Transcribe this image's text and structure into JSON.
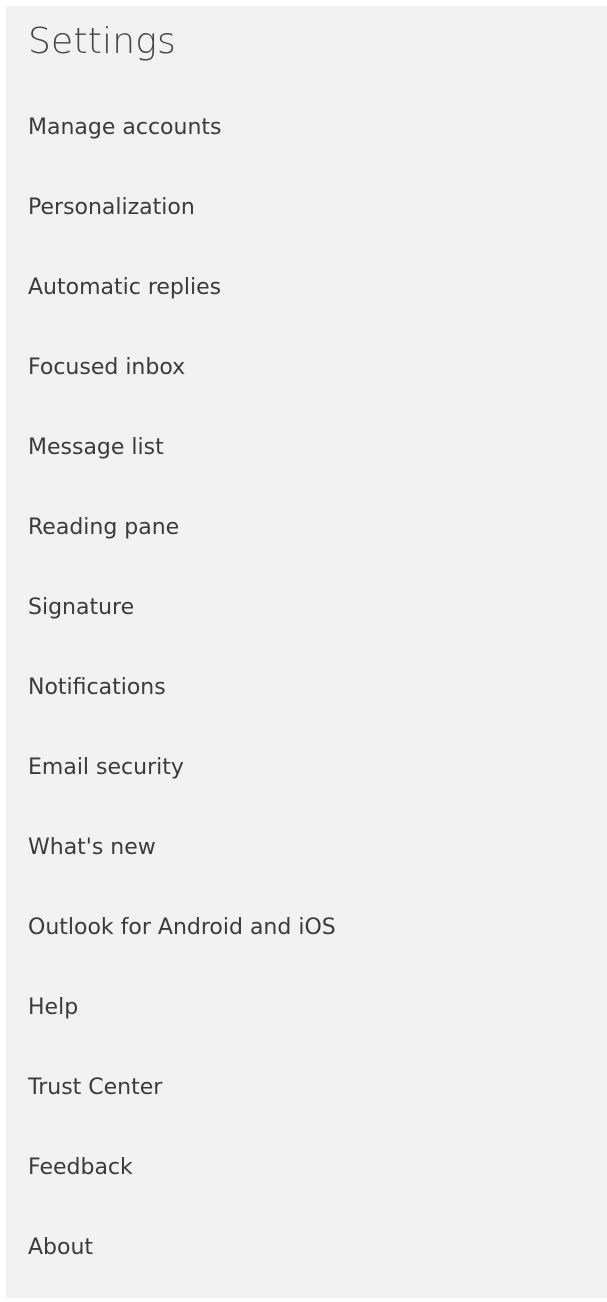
{
  "settings": {
    "title": "Settings",
    "items": [
      {
        "label": "Manage accounts"
      },
      {
        "label": "Personalization"
      },
      {
        "label": "Automatic replies"
      },
      {
        "label": "Focused inbox"
      },
      {
        "label": "Message list"
      },
      {
        "label": "Reading pane"
      },
      {
        "label": "Signature"
      },
      {
        "label": "Notifications"
      },
      {
        "label": "Email security"
      },
      {
        "label": "What's new"
      },
      {
        "label": "Outlook for Android and iOS"
      },
      {
        "label": "Help"
      },
      {
        "label": "Trust Center"
      },
      {
        "label": "Feedback"
      },
      {
        "label": "About"
      }
    ]
  },
  "colors": {
    "panel_background": "#f2f2f2",
    "title_text": "#444444",
    "item_text": "#3b3b3b"
  }
}
